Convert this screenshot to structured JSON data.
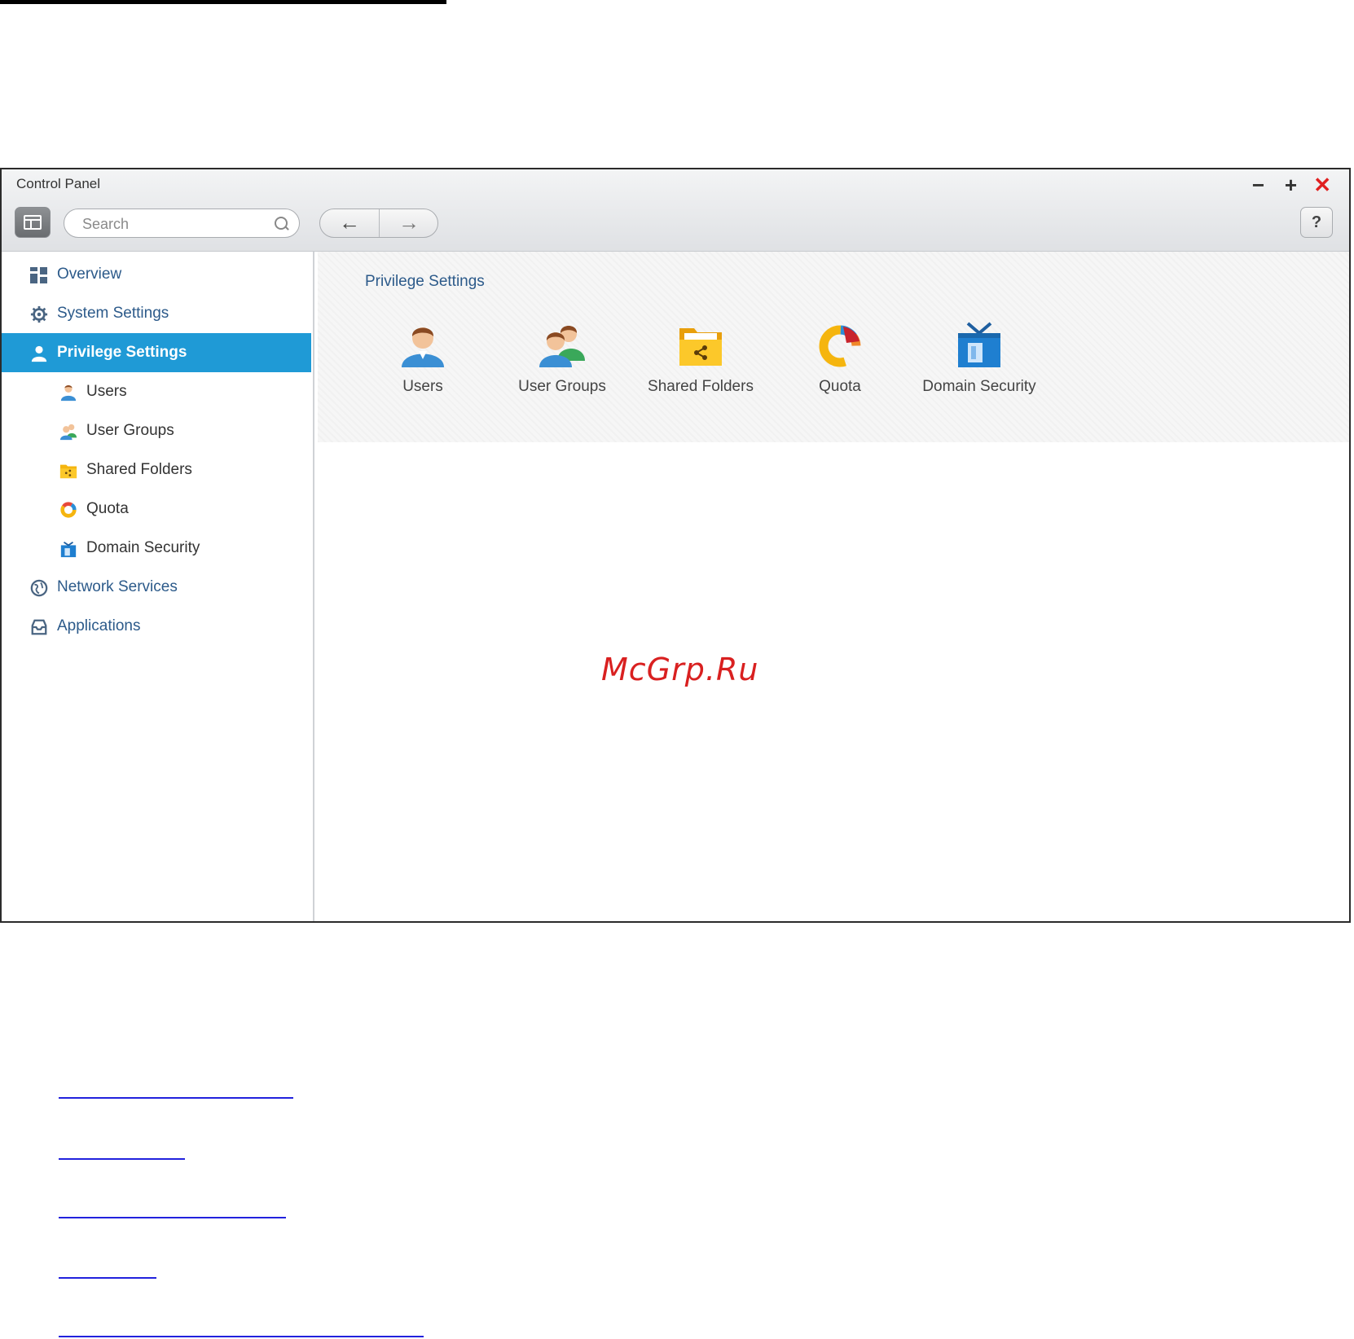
{
  "window": {
    "title": "Control Panel",
    "controls": {
      "minimize": "−",
      "maximize": "+",
      "close": "✕"
    }
  },
  "toolbar": {
    "search_placeholder": "Search",
    "back": "←",
    "forward": "→",
    "help": "?"
  },
  "sidebar": {
    "items": [
      {
        "label": "Overview",
        "icon": "overview-icon"
      },
      {
        "label": "System Settings",
        "icon": "gear-icon"
      },
      {
        "label": "Privilege Settings",
        "icon": "user-icon",
        "active": true
      },
      {
        "label": "Users",
        "icon": "user-icon"
      },
      {
        "label": "User Groups",
        "icon": "user-group-icon"
      },
      {
        "label": "Shared Folders",
        "icon": "shared-folder-icon"
      },
      {
        "label": "Quota",
        "icon": "quota-icon"
      },
      {
        "label": "Domain Security",
        "icon": "domain-security-icon"
      },
      {
        "label": "Network Services",
        "icon": "globe-icon"
      },
      {
        "label": "Applications",
        "icon": "applications-icon"
      }
    ]
  },
  "main": {
    "section_title": "Privilege Settings",
    "tiles": [
      {
        "label": "Users",
        "icon": "user-icon"
      },
      {
        "label": "User Groups",
        "icon": "user-group-icon"
      },
      {
        "label": "Shared Folders",
        "icon": "shared-folder-icon"
      },
      {
        "label": "Quota",
        "icon": "quota-icon"
      },
      {
        "label": "Domain Security",
        "icon": "domain-security-icon"
      }
    ]
  },
  "watermark": "McGrp.Ru",
  "colors": {
    "accent": "#1f9ad6",
    "nav_text": "#2c5a8a",
    "close": "#e02020",
    "watermark": "#d92020",
    "links": "#2222dd"
  }
}
